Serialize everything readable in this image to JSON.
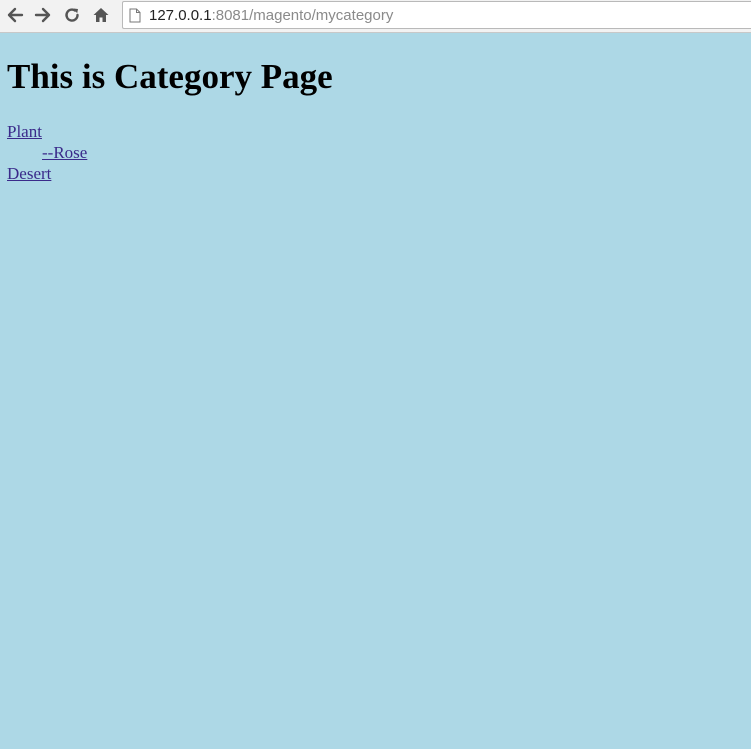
{
  "browser": {
    "url_host": "127.0.0.1",
    "url_rest": ":8081/magento/mycategory",
    "icons": {
      "back": "arrow-left-icon",
      "forward": "arrow-right-icon",
      "reload": "reload-icon",
      "home": "home-icon",
      "page": "page-icon"
    }
  },
  "page": {
    "title": "This is Category Page",
    "background_color": "#add8e6",
    "link_color": "#3a2a8a"
  },
  "categories": [
    {
      "label": "Plant",
      "level": 0
    },
    {
      "label": "--Rose",
      "level": 1
    },
    {
      "label": "Desert",
      "level": 0
    }
  ]
}
